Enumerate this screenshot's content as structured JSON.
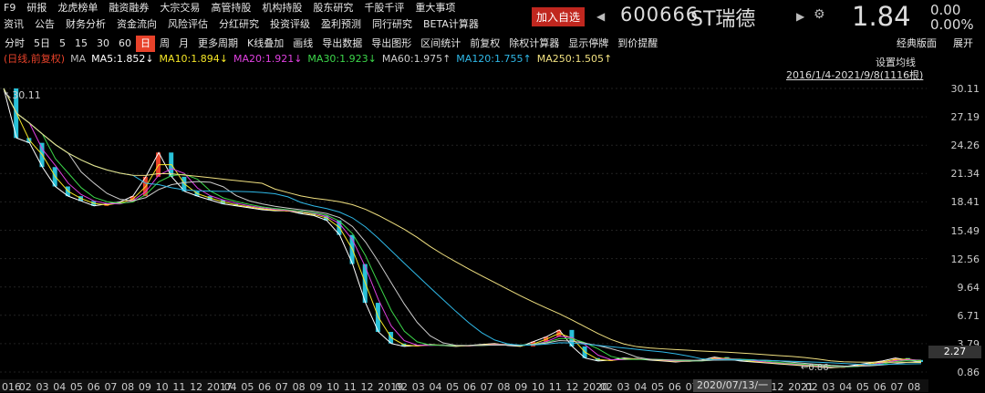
{
  "menu_row1": [
    "F9",
    "研报",
    "龙虎榜单",
    "融资融券",
    "大宗交易",
    "高管持股",
    "机构持股",
    "股东研究",
    "千股千评",
    "重大事项"
  ],
  "menu_row2": [
    "资讯",
    "公告",
    "财务分析",
    "资金流向",
    "风险评估",
    "分红研究",
    "投资评级",
    "盈利预测",
    "同行研究",
    "BETA计算器"
  ],
  "header": {
    "add_watch": "加入自选",
    "code": "600666",
    "name": "ST瑞德",
    "price": "1.84",
    "change": "0.00",
    "change_pct": "0.00%"
  },
  "toolbar": [
    "分时",
    "5日",
    "5",
    "15",
    "30",
    "60",
    "日",
    "周",
    "月",
    "更多周期",
    "K线叠加",
    "画线",
    "导出数据",
    "导出图形",
    "区间统计",
    "前复权",
    "除权计算器",
    "显示停牌",
    "到价提醒"
  ],
  "toolbar_active": "日",
  "toolbar_right": [
    "经典版面",
    "展开"
  ],
  "ma_legend": [
    {
      "text": "(日线,前复权)",
      "color": "#e8422a"
    },
    {
      "text": "MA",
      "color": "#bbbbbb"
    },
    {
      "text": "MA5:1.852↓",
      "color": "#ffffff"
    },
    {
      "text": "MA10:1.894↓",
      "color": "#f5e626"
    },
    {
      "text": "MA20:1.921↓",
      "color": "#e040e0"
    },
    {
      "text": "MA30:1.923↓",
      "color": "#3cd64a"
    },
    {
      "text": "MA60:1.975↑",
      "color": "#cccccc"
    },
    {
      "text": "MA120:1.755↑",
      "color": "#2fb9e8"
    },
    {
      "text": "MA250:1.505↑",
      "color": "#f0e080"
    }
  ],
  "settings_label": "设置均线",
  "range_label": "2016/1/4-2021/9/8(1116根)",
  "high_marker": "30.11",
  "low_marker": "0.86",
  "current_price_tag": "2.27",
  "date_tip": "2020/07/13/一",
  "chart_data": {
    "type": "line",
    "y_ticks": [
      "30.11",
      "27.19",
      "24.26",
      "21.34",
      "18.41",
      "15.49",
      "12.56",
      "9.64",
      "6.71",
      "3.79",
      "0.86"
    ],
    "x_ticks": [
      "016",
      "02",
      "03",
      "04",
      "05",
      "06",
      "07",
      "08",
      "09",
      "10",
      "11",
      "12",
      "2017",
      "04",
      "05",
      "06",
      "07",
      "08",
      "09",
      "10",
      "11",
      "12",
      "2019",
      "02",
      "03",
      "04",
      "05",
      "06",
      "07",
      "08",
      "09",
      "10",
      "11",
      "12",
      "2020",
      "02",
      "03",
      "04",
      "05",
      "06",
      "07",
      "08",
      "09",
      "10",
      "11",
      "12",
      "2021",
      "02",
      "03",
      "04",
      "05",
      "06",
      "07",
      "08"
    ],
    "ylim": [
      0.86,
      30.11
    ],
    "price_series": [
      30.11,
      25,
      24.5,
      22,
      20,
      19,
      18.5,
      18,
      18.2,
      18.4,
      19,
      21,
      23.5,
      21,
      19.5,
      19,
      18.6,
      18.2,
      18,
      17.8,
      17.6,
      17.5,
      17.5,
      17.2,
      17,
      16.5,
      15,
      12,
      8,
      5,
      3.8,
      3.5,
      3.6,
      3.7,
      3.6,
      3.5,
      3.6,
      3.7,
      3.8,
      3.6,
      3.5,
      4,
      4.5,
      5.2,
      3.5,
      2.3,
      2,
      2.1,
      2.3,
      2.2,
      2.1,
      2,
      1.9,
      2,
      2.1,
      2.4,
      2.2,
      2,
      1.9,
      1.8,
      1.7,
      1.6,
      1.5,
      1.4,
      1.3,
      1.4,
      1.6,
      1.8,
      2,
      2.3,
      2.1,
      1.9
    ]
  }
}
